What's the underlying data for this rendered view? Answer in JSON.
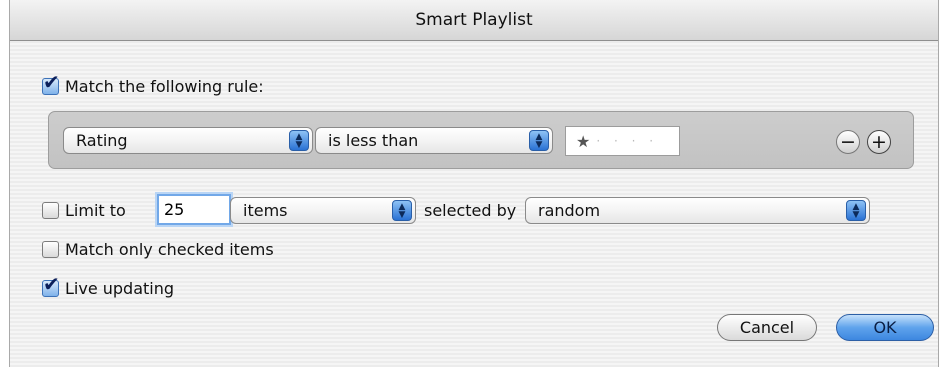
{
  "window": {
    "title": "Smart Playlist"
  },
  "match_rule": {
    "label": "Match the following rule:",
    "checked": true
  },
  "rule": {
    "field": "Rating",
    "operator": "is less than",
    "value_stars": 1,
    "value_display": "★",
    "empty_star_dots": "· · · ·",
    "remove_symbol": "−",
    "add_symbol": "+"
  },
  "limit": {
    "label": "Limit to",
    "checked": false,
    "amount": "25",
    "unit": "items",
    "selected_by_label": "selected by",
    "selected_by": "random"
  },
  "match_checked_only": {
    "label": "Match only checked items",
    "checked": false
  },
  "live_updating": {
    "label": "Live updating",
    "checked": true
  },
  "buttons": {
    "cancel": "Cancel",
    "ok": "OK"
  },
  "colors": {
    "accent": "#3d87e0",
    "focus_ring": "#72a8e8"
  }
}
